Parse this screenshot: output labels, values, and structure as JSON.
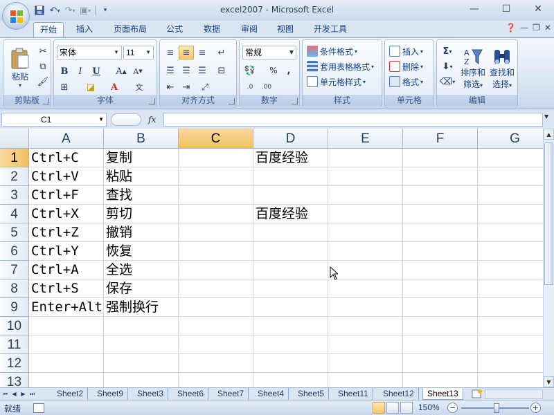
{
  "window": {
    "title": "excel2007 - Microsoft Excel",
    "minimize": "—",
    "maximize": "☐",
    "close": "✕"
  },
  "tabs": [
    {
      "label": "开始",
      "active": true
    },
    {
      "label": "插入"
    },
    {
      "label": "页面布局"
    },
    {
      "label": "公式"
    },
    {
      "label": "数据"
    },
    {
      "label": "审阅"
    },
    {
      "label": "视图"
    },
    {
      "label": "开发工具"
    }
  ],
  "ribbon": {
    "clipboard": {
      "label": "剪贴板",
      "paste": "粘贴"
    },
    "font": {
      "label": "字体",
      "name": "宋体",
      "size": "11"
    },
    "alignment": {
      "label": "对齐方式"
    },
    "number": {
      "label": "数字",
      "format": "常规"
    },
    "styles": {
      "label": "样式",
      "conditional": "条件格式",
      "table": "套用表格格式",
      "cell": "单元格样式"
    },
    "cells": {
      "label": "单元格",
      "insert": "插入",
      "delete": "删除",
      "format": "格式"
    },
    "editing": {
      "label": "编辑",
      "sort": "排序和",
      "filter": "筛选",
      "find": "查找和",
      "select": "选择"
    }
  },
  "formula_bar": {
    "name_box": "C1",
    "fx": "fx",
    "value": ""
  },
  "grid": {
    "columns": [
      "A",
      "B",
      "C",
      "D",
      "E",
      "F",
      "G"
    ],
    "selected_column": "C",
    "rows": [
      "1",
      "2",
      "3",
      "4",
      "5",
      "6",
      "7",
      "8",
      "9",
      "10",
      "11",
      "12",
      "13"
    ],
    "selected_row": "1",
    "cells": {
      "A1": "Ctrl+C",
      "B1": "复制",
      "D1": "百度经验",
      "A2": "Ctrl+V",
      "B2": "粘贴",
      "A3": "Ctrl+F",
      "B3": "查找",
      "A4": "Ctrl+X",
      "B4": "剪切",
      "D4": "百度经验",
      "A5": "Ctrl+Z",
      "B5": "撤销",
      "A6": "Ctrl+Y",
      "B6": "恢复",
      "A7": "Ctrl+A",
      "B7": "全选",
      "A8": "Ctrl+S",
      "B8": "保存",
      "A9": "Enter+Alt",
      "B9": "强制换行"
    }
  },
  "sheets": [
    "Sheet2",
    "Sheet9",
    "Sheet3",
    "Sheet6",
    "Sheet7",
    "Sheet4",
    "Sheet5",
    "Sheet11",
    "Sheet12",
    "Sheet13"
  ],
  "active_sheet": "Sheet13",
  "status": {
    "ready": "就绪",
    "zoom": "150%",
    "zoom_minus": "−",
    "zoom_plus": "+"
  }
}
